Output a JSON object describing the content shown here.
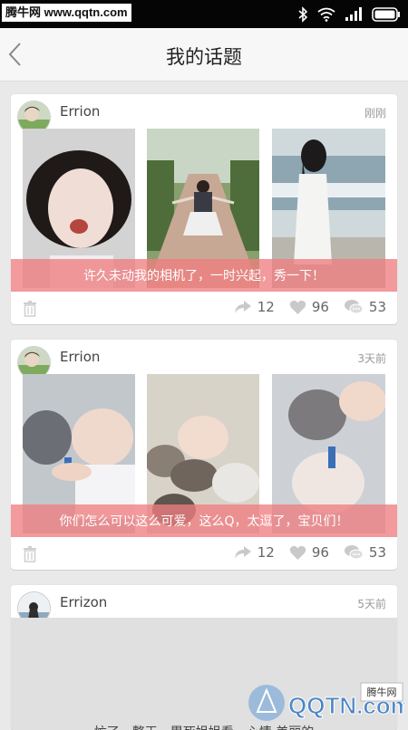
{
  "status_bar": {
    "watermark": "腾牛网 www.qqtn.com"
  },
  "header": {
    "title": "我的话题"
  },
  "posts": [
    {
      "author": "Errion",
      "time": "刚刚",
      "caption": "许久未动我的相机了，一时兴起，秀一下！",
      "shares": "12",
      "likes": "96",
      "comments": "53"
    },
    {
      "author": "Errion",
      "time": "3天前",
      "caption": "你们怎么可以这么可爱，这么Q，太逗了，宝贝们！",
      "shares": "12",
      "likes": "96",
      "comments": "53"
    },
    {
      "author": "Errizon",
      "time": "5天前",
      "text": "忙了一整天，累死姐姐看，心情 美丽的"
    }
  ],
  "watermark_logo": {
    "text": "QQTN.com",
    "badge": "腾牛网"
  },
  "colors": {
    "caption_band": "#ee7e80",
    "card_bg": "#ffffff",
    "page_bg": "#e9e9e9"
  }
}
